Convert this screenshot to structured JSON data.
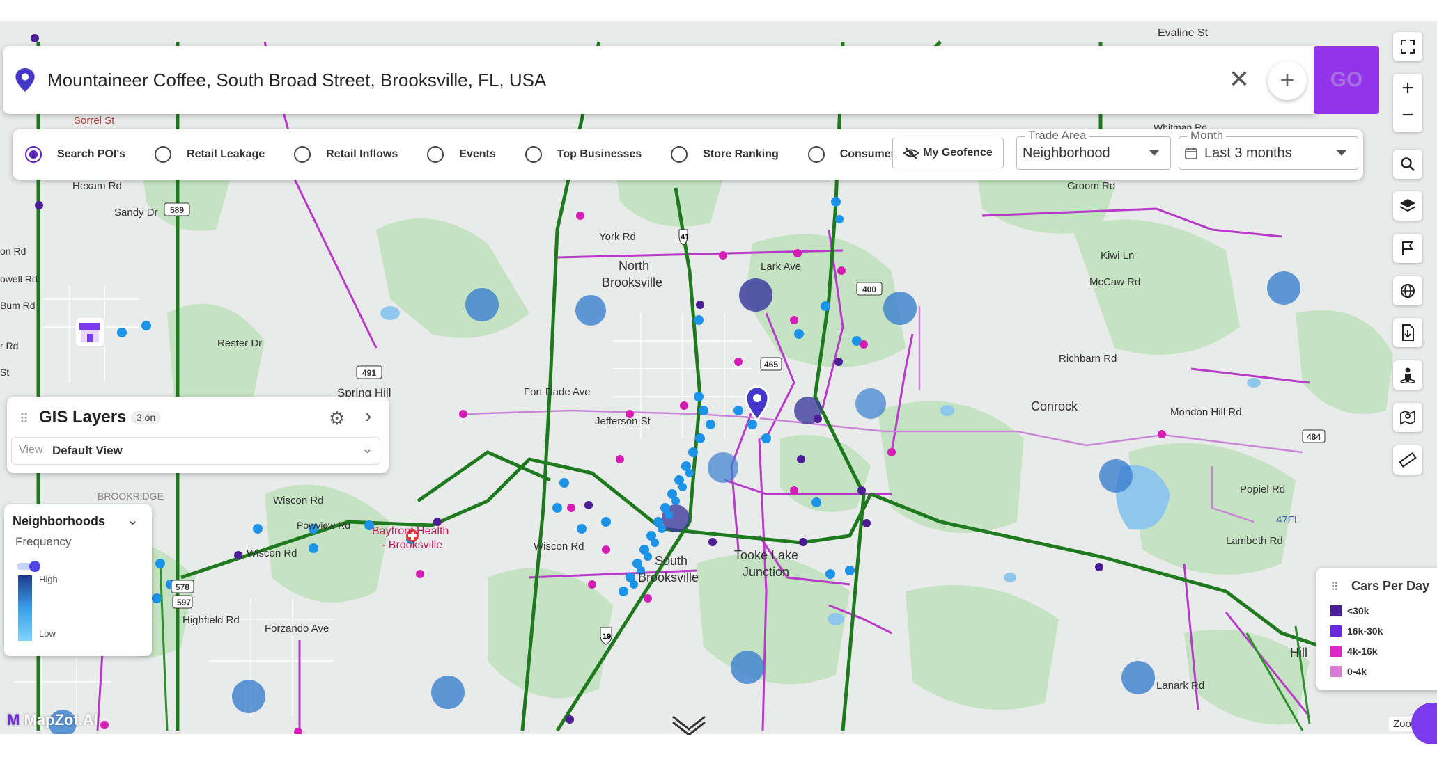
{
  "search": {
    "address": "Mountaineer Coffee, South Broad Street, Brooksville, FL, USA",
    "go_label": "GO"
  },
  "filters": {
    "options": [
      {
        "label": "Search POI's",
        "selected": true
      },
      {
        "label": "Retail Leakage",
        "selected": false
      },
      {
        "label": "Retail Inflows",
        "selected": false
      },
      {
        "label": "Events",
        "selected": false
      },
      {
        "label": "Top Businesses",
        "selected": false
      },
      {
        "label": "Store Ranking",
        "selected": false
      },
      {
        "label": "Consumer Spending",
        "selected": false
      }
    ],
    "geofence_label": "My Geofence",
    "trade_area": {
      "label": "Trade Area",
      "value": "Neighborhood"
    },
    "month": {
      "label": "Month",
      "value": "Last 3 months"
    }
  },
  "gis": {
    "title": "GIS Layers",
    "badge": "3 on",
    "view_key": "View",
    "view_value": "Default View"
  },
  "neighborhoods": {
    "title": "Neighborhoods",
    "subtitle": "Frequency",
    "high": "High",
    "low": "Low"
  },
  "cars": {
    "title": "Cars Per Day",
    "items": [
      {
        "label": "<30k",
        "color": "#4c1d95"
      },
      {
        "label": "16k-30k",
        "color": "#6d28d9"
      },
      {
        "label": "4k-16k",
        "color": "#db27c6"
      },
      {
        "label": "0-4k",
        "color": "#d97ad9"
      }
    ]
  },
  "map": {
    "brand": "MapZot.AI",
    "zoom_label": "Zoom",
    "labels": {
      "evaline": "Evaline St",
      "sorrel": "Sorrel St",
      "whitman": "Whitman Rd",
      "hexam": "Hexam Rd",
      "sandy": "Sandy Dr",
      "on_rd": "on Rd",
      "owell": "owell Rd",
      "bum": "Bum Rd",
      "r_rd": "r Rd",
      "st": "St",
      "york": "York Rd",
      "north": "North",
      "brooksville": "Brooksville",
      "lark": "Lark Ave",
      "kiwi": "Kiwi Ln",
      "mccaw": "McCaw Rd",
      "groom": "Groom Rd",
      "rester": "Rester Dr",
      "spring_hill": "Spring Hill",
      "fort_dade": "Fort Dade Ave",
      "jefferson": "Jefferson St",
      "conrock": "Conrock",
      "mondon": "Mondon Hill Rd",
      "richbarn": "Richbarn Rd",
      "brookridge": "BROOKRIDGE",
      "wiscon1": "Wiscon Rd",
      "powview": "Powview Rd",
      "bayfront1": "Bayfront Health",
      "bayfront2": "- Brooksville",
      "wiscon2": "Wiscon Rd",
      "wiscon3": "Wiscon Rd",
      "south1": "South",
      "south2": "Brooksville",
      "tooke1": "Tooke Lake",
      "tooke2": "Junction",
      "popiel": "Popiel Rd",
      "lambeth": "Lambeth Rd",
      "hill": "Hill",
      "lanark": "Lanark Rd",
      "fl47": "47FL",
      "highfield": "Highfield Rd",
      "forzando": "Forzando Ave",
      "us19": "19",
      "us41": "41"
    }
  }
}
